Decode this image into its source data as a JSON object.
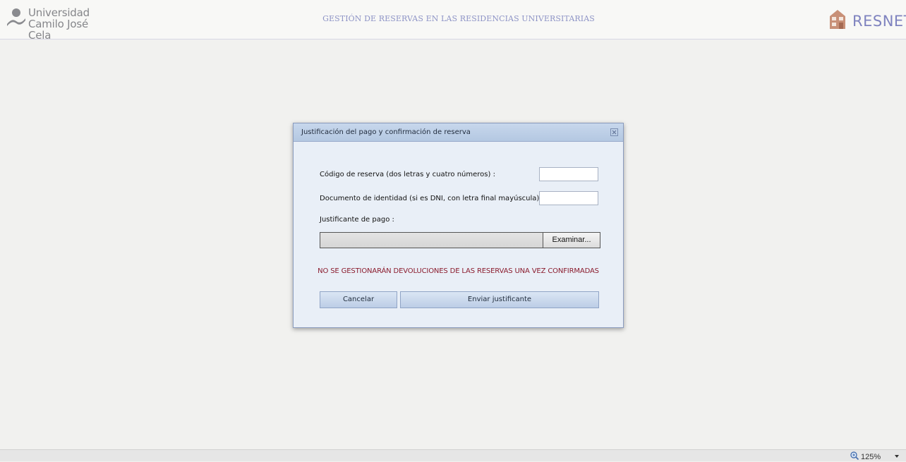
{
  "header": {
    "logo_line1": "Universidad",
    "logo_line2": "Camilo José Cela",
    "title": "GESTIÓN DE RESERVAS EN LAS RESIDENCIAS UNIVERSITARIAS",
    "brand": "RESNET",
    "brand_color": "#7f83bf",
    "title_color": "#8e94c6"
  },
  "dialog": {
    "title": "Justificación del pago y confirmación de reserva",
    "close_icon": "close-icon",
    "fields": {
      "reservation_code_label": "Código de reserva (dos letras y cuatro números) :",
      "reservation_code_value": "",
      "id_document_label": "Documento de identidad (si es DNI, con letra final mayúscula) :",
      "id_document_value": "",
      "payment_proof_label": "Justificante de pago :",
      "payment_proof_path": "",
      "browse_button": "Examinar..."
    },
    "warning": "NO SE GESTIONARÁN DEVOLUCIONES DE LAS RESERVAS UNA VEZ CONFIRMADAS",
    "warning_color": "#8b1c2e",
    "buttons": {
      "cancel": "Cancelar",
      "submit": "Enviar justificante"
    }
  },
  "statusbar": {
    "zoom": "125%",
    "zoom_icon": "zoom-icon"
  }
}
